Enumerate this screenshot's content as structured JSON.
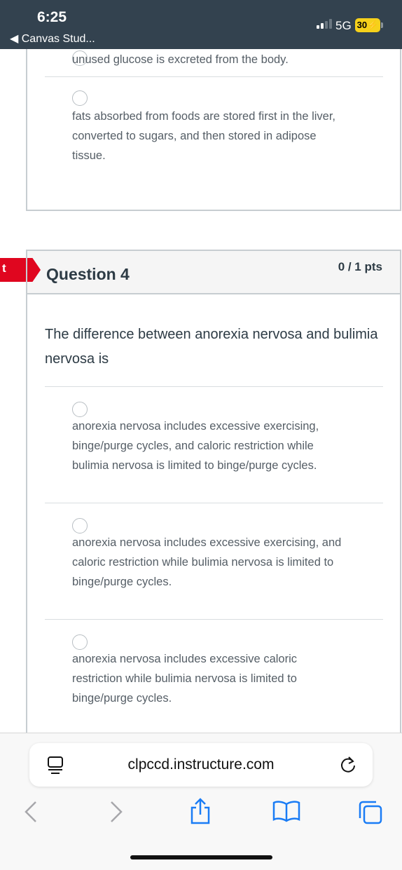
{
  "status_bar": {
    "time": "6:25",
    "back_app": "◀ Canvas Stud...",
    "network": "5G",
    "battery": "30"
  },
  "previous_question": {
    "answers": [
      "unused glucose is excreted from the body.",
      "fats absorbed from foods are stored first in the liver, converted to sugars, and then stored in adipose tissue."
    ]
  },
  "question": {
    "flag_label": "t",
    "title": "Question 4",
    "points": "0 / 1 pts",
    "text": "The difference between anorexia nervosa and bulimia nervosa is",
    "answers": [
      "anorexia nervosa includes excessive exercising, binge/purge cycles, and caloric restriction while bulimia nervosa is limited to binge/purge cycles.",
      "anorexia nervosa includes excessive exercising, and caloric restriction while bulimia nervosa is limited to binge/purge cycles.",
      "anorexia nervosa includes excessive caloric restriction while bulimia nervosa is limited to binge/purge cycles."
    ]
  },
  "browser": {
    "url": "clpccd.instructure.com",
    "icons": [
      "reader-icon",
      "reload-icon",
      "back-icon",
      "forward-icon",
      "share-icon",
      "bookmarks-icon",
      "tabs-icon"
    ]
  },
  "colors": {
    "status_bar": "#33424f",
    "incorrect_flag": "#e0061f",
    "battery": "#f6d11b"
  }
}
